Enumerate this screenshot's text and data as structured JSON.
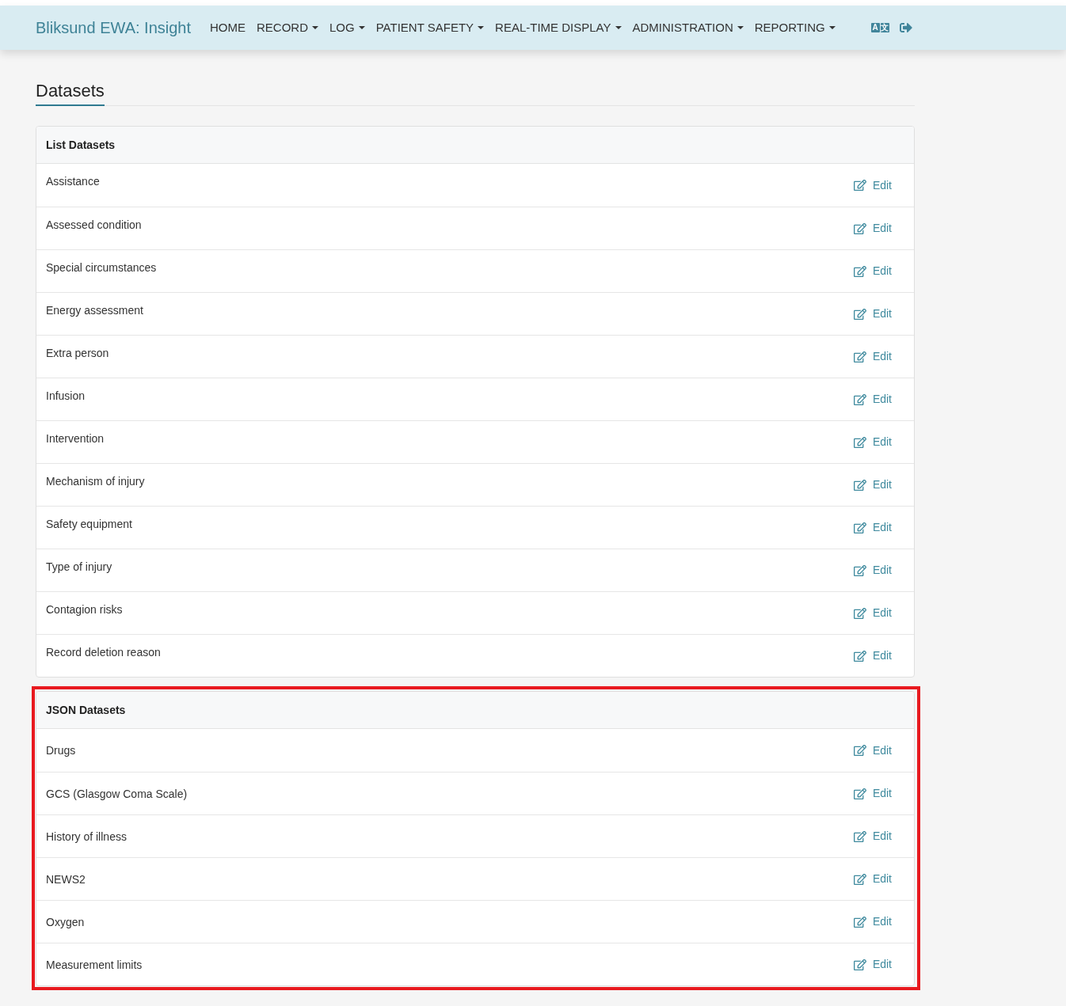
{
  "navbar": {
    "brand": "Bliksund EWA: Insight",
    "menu": [
      {
        "label": "HOME",
        "dropdown": false
      },
      {
        "label": "RECORD",
        "dropdown": true
      },
      {
        "label": "LOG",
        "dropdown": true
      },
      {
        "label": "PATIENT SAFETY",
        "dropdown": true
      },
      {
        "label": "REAL-TIME DISPLAY",
        "dropdown": true
      },
      {
        "label": "ADMINISTRATION",
        "dropdown": true
      },
      {
        "label": "REPORTING",
        "dropdown": true
      }
    ],
    "language_button": [
      "A",
      "文"
    ]
  },
  "page": {
    "title": "Datasets"
  },
  "panels": [
    {
      "kind": "list",
      "title": "List Datasets",
      "highlighted": false,
      "rows": [
        {
          "name": "Assistance",
          "action": "Edit"
        },
        {
          "name": "Assessed condition",
          "action": "Edit"
        },
        {
          "name": "Special circumstances",
          "action": "Edit"
        },
        {
          "name": "Energy assessment",
          "action": "Edit"
        },
        {
          "name": "Extra person",
          "action": "Edit"
        },
        {
          "name": "Infusion",
          "action": "Edit"
        },
        {
          "name": "Intervention",
          "action": "Edit"
        },
        {
          "name": "Mechanism of injury",
          "action": "Edit"
        },
        {
          "name": "Safety equipment",
          "action": "Edit"
        },
        {
          "name": "Type of injury",
          "action": "Edit"
        },
        {
          "name": "Contagion risks",
          "action": "Edit"
        },
        {
          "name": "Record deletion reason",
          "action": "Edit"
        }
      ]
    },
    {
      "kind": "json",
      "title": "JSON Datasets",
      "highlighted": true,
      "rows": [
        {
          "name": "Drugs",
          "action": "Edit"
        },
        {
          "name": "GCS (Glasgow Coma Scale)",
          "action": "Edit"
        },
        {
          "name": "History of illness",
          "action": "Edit"
        },
        {
          "name": "NEWS2",
          "action": "Edit"
        },
        {
          "name": "Oxygen",
          "action": "Edit"
        },
        {
          "name": "Measurement limits",
          "action": "Edit"
        }
      ]
    }
  ]
}
